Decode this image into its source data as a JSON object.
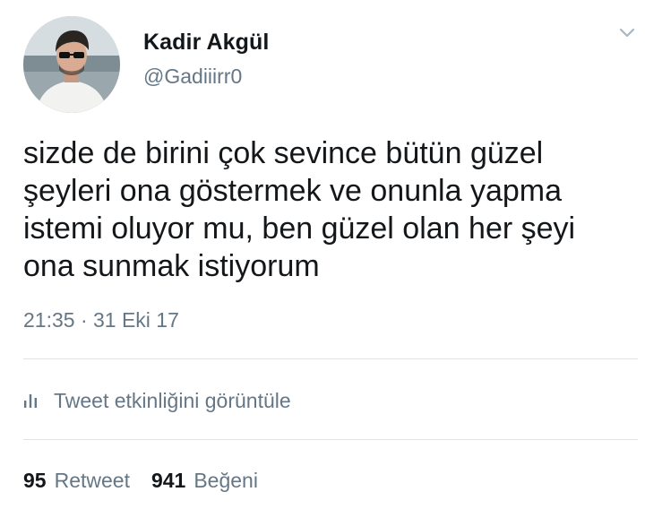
{
  "tweet": {
    "author": {
      "display_name": "Kadir Akgül",
      "handle": "@Gadiiirr0",
      "avatar_icon": "profile-photo"
    },
    "menu_icon": "chevron-down-icon",
    "text": "sizde de birini çok sevince bütün güzel şeyleri ona göstermek ve onunla yapma istemi oluyor mu, ben güzel olan her şeyi ona sunmak istiyorum",
    "timestamp": "21:35 · 31 Eki 17",
    "activity": {
      "icon": "bar-chart-icon",
      "label": "Tweet etkinliğini görüntüle"
    },
    "stats": {
      "retweets": {
        "count": "95",
        "label": "Retweet"
      },
      "likes": {
        "count": "941",
        "label": "Beğeni"
      }
    }
  },
  "colors": {
    "text_primary": "#14171a",
    "text_secondary": "#657786",
    "divider": "#dfe3e6"
  }
}
